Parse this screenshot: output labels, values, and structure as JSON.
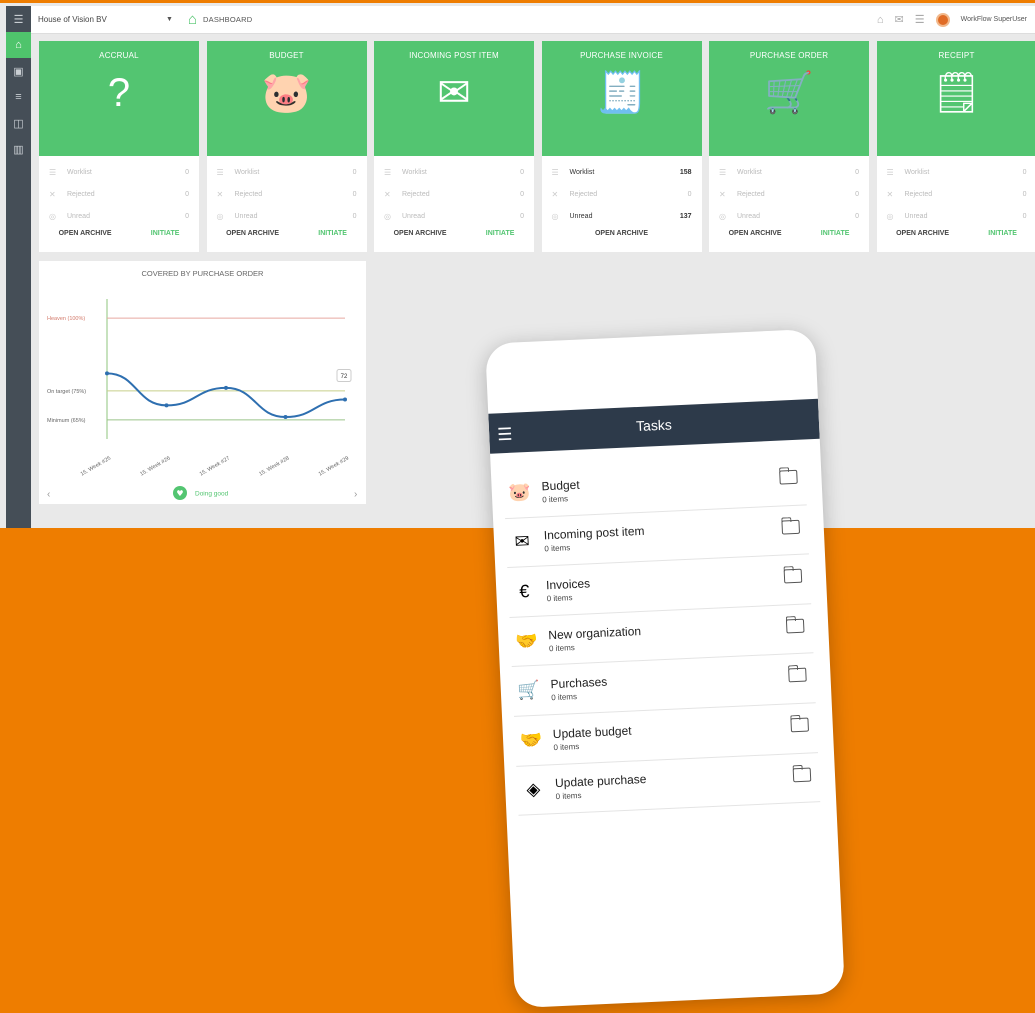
{
  "topbar": {
    "company": "House of Vision BV",
    "breadcrumb": "DASHBOARD",
    "user": "WorkFlow SuperUser"
  },
  "cards": [
    {
      "title": "ACCRUAL",
      "icon": "question-circle-icon",
      "rows": [
        {
          "label": "Worklist",
          "value": "0"
        },
        {
          "label": "Rejected",
          "value": "0"
        },
        {
          "label": "Unread",
          "value": "0"
        }
      ],
      "open_archive": "OPEN ARCHIVE",
      "initiate": "INITIATE"
    },
    {
      "title": "BUDGET",
      "icon": "piggy-bank-icon",
      "rows": [
        {
          "label": "Worklist",
          "value": "0"
        },
        {
          "label": "Rejected",
          "value": "0"
        },
        {
          "label": "Unread",
          "value": "0"
        }
      ],
      "open_archive": "OPEN ARCHIVE",
      "initiate": "INITIATE"
    },
    {
      "title": "INCOMING POST ITEM",
      "icon": "envelope-icon",
      "rows": [
        {
          "label": "Worklist",
          "value": "0"
        },
        {
          "label": "Rejected",
          "value": "0"
        },
        {
          "label": "Unread",
          "value": "0"
        }
      ],
      "open_archive": "OPEN ARCHIVE",
      "initiate": "INITIATE"
    },
    {
      "title": "PURCHASE INVOICE",
      "icon": "invoice-icon",
      "rows": [
        {
          "label": "Worklist",
          "value": "158"
        },
        {
          "label": "Rejected",
          "value": "0"
        },
        {
          "label": "Unread",
          "value": "137"
        }
      ],
      "open_archive": "OPEN ARCHIVE",
      "initiate": ""
    },
    {
      "title": "PURCHASE ORDER",
      "icon": "cart-icon",
      "rows": [
        {
          "label": "Worklist",
          "value": "0"
        },
        {
          "label": "Rejected",
          "value": "0"
        },
        {
          "label": "Unread",
          "value": "0"
        }
      ],
      "open_archive": "OPEN ARCHIVE",
      "initiate": "INITIATE"
    },
    {
      "title": "RECEIPT",
      "icon": "receipt-icon",
      "rows": [
        {
          "label": "Worklist",
          "value": "0"
        },
        {
          "label": "Rejected",
          "value": "0"
        },
        {
          "label": "Unread",
          "value": "0"
        }
      ],
      "open_archive": "OPEN ARCHIVE",
      "initiate": "INITIATE"
    }
  ],
  "chart_data": {
    "type": "line",
    "title": "COVERED BY PURCHASE ORDER",
    "categories": [
      "15. Week #25",
      "15. Week #26",
      "15. Week #27",
      "15. Week #28",
      "15. Week #29"
    ],
    "values": [
      81,
      70,
      76,
      66,
      72
    ],
    "ylim": [
      55,
      110
    ],
    "reference_lines": [
      {
        "label": "Heaven (100%)",
        "value": 100,
        "color": "#e8a9a0"
      },
      {
        "label": "On target (75%)",
        "value": 75,
        "color": "#c8cf8a"
      },
      {
        "label": "Minimum (65%)",
        "value": 65,
        "color": "#9bc48a"
      }
    ],
    "last_value_label": "72",
    "status": "Doing good",
    "nav_prev": "‹",
    "nav_next": "›",
    "line_color": "#2e6fb0"
  },
  "phone": {
    "title": "Tasks",
    "tasks": [
      {
        "name": "Budget",
        "count": "0 items",
        "icon": "piggy-bank-icon"
      },
      {
        "name": "Incoming post item",
        "count": "0 items",
        "icon": "envelope-icon"
      },
      {
        "name": "Invoices",
        "count": "0 items",
        "icon": "euro-invoice-icon"
      },
      {
        "name": "New organization",
        "count": "0 items",
        "icon": "handshake-icon"
      },
      {
        "name": "Purchases",
        "count": "0 items",
        "icon": "cart-document-icon"
      },
      {
        "name": "Update budget",
        "count": "0 items",
        "icon": "handshake-icon"
      },
      {
        "name": "Update purchase",
        "count": "0 items",
        "icon": "diamond-handshake-icon"
      }
    ]
  },
  "colors": {
    "brand_green": "#53c571",
    "orange_bg": "#ee7d00",
    "phone_bar": "#2d3a4a",
    "sidebar": "#454e57"
  }
}
